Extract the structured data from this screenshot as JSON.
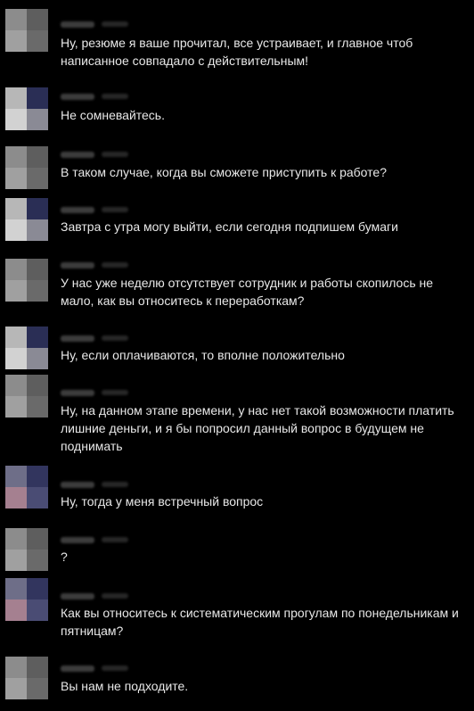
{
  "messages": [
    {
      "sender": "employer",
      "text": "Ну, резюме я ваше прочитал, все устраивает, и главное чтоб написанное совпадало с действительным!"
    },
    {
      "sender": "candidate",
      "text": "Не сомневайтесь."
    },
    {
      "sender": "employer",
      "text": "В таком случае, когда вы сможете приступить к работе?"
    },
    {
      "sender": "candidate",
      "text": "Завтра с утра могу выйти, если сегодня подпишем бумаги"
    },
    {
      "sender": "employer",
      "text": "У нас уже неделю отсутствует сотрудник и работы скопилось не мало, как вы относитесь к переработкам?"
    },
    {
      "sender": "candidate",
      "text": "Ну, если оплачиваются, то вполне положительно"
    },
    {
      "sender": "employer",
      "text": "Ну, на данном этапе времени, у нас нет такой возможности платить лишние деньги, и я бы попросил данный вопрос в будущем не поднимать"
    },
    {
      "sender": "candidate",
      "text": "Ну, тогда у меня встречный вопрос"
    },
    {
      "sender": "employer",
      "text": "?"
    },
    {
      "sender": "candidate",
      "text": "Как вы относитесь к систематическим прогулам по понедельникам и пятницам?"
    },
    {
      "sender": "employer",
      "text": "Вы нам не подходите."
    }
  ]
}
